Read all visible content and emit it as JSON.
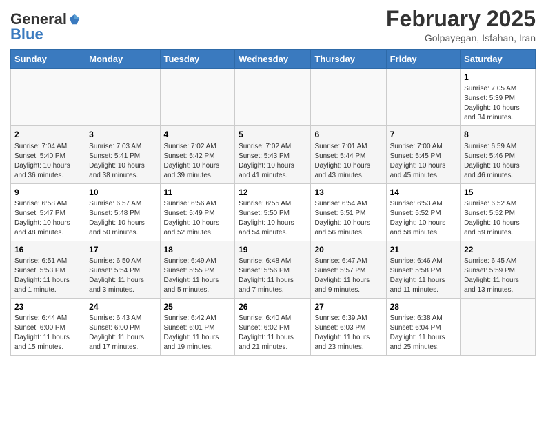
{
  "header": {
    "logo": {
      "general": "General",
      "blue": "Blue"
    },
    "title": "February 2025",
    "location": "Golpayegan, Isfahan, Iran"
  },
  "weekdays": [
    "Sunday",
    "Monday",
    "Tuesday",
    "Wednesday",
    "Thursday",
    "Friday",
    "Saturday"
  ],
  "weeks": [
    [
      {
        "day": "",
        "info": ""
      },
      {
        "day": "",
        "info": ""
      },
      {
        "day": "",
        "info": ""
      },
      {
        "day": "",
        "info": ""
      },
      {
        "day": "",
        "info": ""
      },
      {
        "day": "",
        "info": ""
      },
      {
        "day": "1",
        "info": "Sunrise: 7:05 AM\nSunset: 5:39 PM\nDaylight: 10 hours\nand 34 minutes."
      }
    ],
    [
      {
        "day": "2",
        "info": "Sunrise: 7:04 AM\nSunset: 5:40 PM\nDaylight: 10 hours\nand 36 minutes."
      },
      {
        "day": "3",
        "info": "Sunrise: 7:03 AM\nSunset: 5:41 PM\nDaylight: 10 hours\nand 38 minutes."
      },
      {
        "day": "4",
        "info": "Sunrise: 7:02 AM\nSunset: 5:42 PM\nDaylight: 10 hours\nand 39 minutes."
      },
      {
        "day": "5",
        "info": "Sunrise: 7:02 AM\nSunset: 5:43 PM\nDaylight: 10 hours\nand 41 minutes."
      },
      {
        "day": "6",
        "info": "Sunrise: 7:01 AM\nSunset: 5:44 PM\nDaylight: 10 hours\nand 43 minutes."
      },
      {
        "day": "7",
        "info": "Sunrise: 7:00 AM\nSunset: 5:45 PM\nDaylight: 10 hours\nand 45 minutes."
      },
      {
        "day": "8",
        "info": "Sunrise: 6:59 AM\nSunset: 5:46 PM\nDaylight: 10 hours\nand 46 minutes."
      }
    ],
    [
      {
        "day": "9",
        "info": "Sunrise: 6:58 AM\nSunset: 5:47 PM\nDaylight: 10 hours\nand 48 minutes."
      },
      {
        "day": "10",
        "info": "Sunrise: 6:57 AM\nSunset: 5:48 PM\nDaylight: 10 hours\nand 50 minutes."
      },
      {
        "day": "11",
        "info": "Sunrise: 6:56 AM\nSunset: 5:49 PM\nDaylight: 10 hours\nand 52 minutes."
      },
      {
        "day": "12",
        "info": "Sunrise: 6:55 AM\nSunset: 5:50 PM\nDaylight: 10 hours\nand 54 minutes."
      },
      {
        "day": "13",
        "info": "Sunrise: 6:54 AM\nSunset: 5:51 PM\nDaylight: 10 hours\nand 56 minutes."
      },
      {
        "day": "14",
        "info": "Sunrise: 6:53 AM\nSunset: 5:52 PM\nDaylight: 10 hours\nand 58 minutes."
      },
      {
        "day": "15",
        "info": "Sunrise: 6:52 AM\nSunset: 5:52 PM\nDaylight: 10 hours\nand 59 minutes."
      }
    ],
    [
      {
        "day": "16",
        "info": "Sunrise: 6:51 AM\nSunset: 5:53 PM\nDaylight: 11 hours\nand 1 minute."
      },
      {
        "day": "17",
        "info": "Sunrise: 6:50 AM\nSunset: 5:54 PM\nDaylight: 11 hours\nand 3 minutes."
      },
      {
        "day": "18",
        "info": "Sunrise: 6:49 AM\nSunset: 5:55 PM\nDaylight: 11 hours\nand 5 minutes."
      },
      {
        "day": "19",
        "info": "Sunrise: 6:48 AM\nSunset: 5:56 PM\nDaylight: 11 hours\nand 7 minutes."
      },
      {
        "day": "20",
        "info": "Sunrise: 6:47 AM\nSunset: 5:57 PM\nDaylight: 11 hours\nand 9 minutes."
      },
      {
        "day": "21",
        "info": "Sunrise: 6:46 AM\nSunset: 5:58 PM\nDaylight: 11 hours\nand 11 minutes."
      },
      {
        "day": "22",
        "info": "Sunrise: 6:45 AM\nSunset: 5:59 PM\nDaylight: 11 hours\nand 13 minutes."
      }
    ],
    [
      {
        "day": "23",
        "info": "Sunrise: 6:44 AM\nSunset: 6:00 PM\nDaylight: 11 hours\nand 15 minutes."
      },
      {
        "day": "24",
        "info": "Sunrise: 6:43 AM\nSunset: 6:00 PM\nDaylight: 11 hours\nand 17 minutes."
      },
      {
        "day": "25",
        "info": "Sunrise: 6:42 AM\nSunset: 6:01 PM\nDaylight: 11 hours\nand 19 minutes."
      },
      {
        "day": "26",
        "info": "Sunrise: 6:40 AM\nSunset: 6:02 PM\nDaylight: 11 hours\nand 21 minutes."
      },
      {
        "day": "27",
        "info": "Sunrise: 6:39 AM\nSunset: 6:03 PM\nDaylight: 11 hours\nand 23 minutes."
      },
      {
        "day": "28",
        "info": "Sunrise: 6:38 AM\nSunset: 6:04 PM\nDaylight: 11 hours\nand 25 minutes."
      },
      {
        "day": "",
        "info": ""
      }
    ]
  ]
}
